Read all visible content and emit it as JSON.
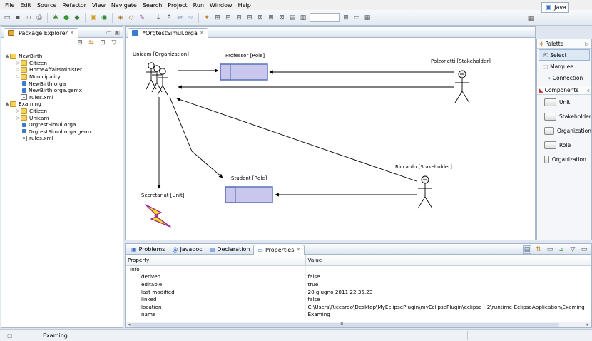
{
  "menu": [
    "File",
    "Edit",
    "Source",
    "Refactor",
    "View",
    "Navigate",
    "Search",
    "Project",
    "Run",
    "Window",
    "Help"
  ],
  "perspective": "Java",
  "package_explorer": {
    "tab_label": "Package Explorer",
    "tree": [
      {
        "label": "NewBirth",
        "icon": "project-icon",
        "level": 0,
        "twisty": "▲"
      },
      {
        "label": "Citizen",
        "icon": "folder-icon",
        "level": 1,
        "twisty": "▷"
      },
      {
        "label": "HomeAffairsMinister",
        "icon": "folder-icon",
        "level": 1,
        "twisty": "▷"
      },
      {
        "label": "Municipality",
        "icon": "folder-icon",
        "level": 1,
        "twisty": "▷"
      },
      {
        "label": "NewBirth.orga",
        "icon": "orga-file-icon",
        "level": 1,
        "twisty": ""
      },
      {
        "label": "NewBirth.orga.gemx",
        "icon": "orga-file-icon",
        "level": 1,
        "twisty": ""
      },
      {
        "label": "rules.xml",
        "icon": "xml-file-icon",
        "level": 1,
        "twisty": ""
      },
      {
        "label": "Examing",
        "icon": "project-icon",
        "level": 0,
        "twisty": "▲"
      },
      {
        "label": "Citizen",
        "icon": "folder-icon",
        "level": 1,
        "twisty": "▷"
      },
      {
        "label": "Unicam",
        "icon": "folder-icon",
        "level": 1,
        "twisty": "▷"
      },
      {
        "label": "OrgtestSimul.orga",
        "icon": "orga-file-icon",
        "level": 1,
        "twisty": ""
      },
      {
        "label": "OrgtestSimul.orga.gemx",
        "icon": "orga-file-icon",
        "level": 1,
        "twisty": ""
      },
      {
        "label": "rules.xml",
        "icon": "xml-file-icon",
        "level": 1,
        "twisty": ""
      }
    ]
  },
  "editor": {
    "tab_label": "*OrgtestSimul.orga",
    "nodes": {
      "unicam": "Unicam [Organization]",
      "professor": "Professor [Role]",
      "polzonetti": "Polzonetti [Stakeholder]",
      "student": "Student [Role]",
      "riccardo": "Riccardo [Stakeholder]",
      "secretariat": "Secretariat [Unit]"
    }
  },
  "palette": {
    "title": "Palette",
    "tools": [
      {
        "label": "Select",
        "icon": "arrow-cursor-icon",
        "selected": true
      },
      {
        "label": "Marquee",
        "icon": "marquee-icon",
        "selected": false
      },
      {
        "label": "Connection",
        "icon": "connection-icon",
        "selected": false
      }
    ],
    "components_title": "Components",
    "components": [
      "Unit",
      "Stakeholder",
      "Organization",
      "Role",
      "Organization..."
    ]
  },
  "bottom_panel": {
    "tabs": [
      {
        "label": "Problems",
        "icon": "problems-icon",
        "active": false
      },
      {
        "label": "Javadoc",
        "icon": "at-icon",
        "active": false
      },
      {
        "label": "Declaration",
        "icon": "declaration-icon",
        "active": false
      },
      {
        "label": "Properties",
        "icon": "properties-icon",
        "active": true
      }
    ],
    "columns": [
      "Property",
      "Value"
    ],
    "rows": [
      {
        "property": "Info",
        "value": "",
        "indent": 1
      },
      {
        "property": "derived",
        "value": "false",
        "indent": 2
      },
      {
        "property": "editable",
        "value": "true",
        "indent": 2
      },
      {
        "property": "last modified",
        "value": "20 giugno 2011 22.35.23",
        "indent": 2
      },
      {
        "property": "linked",
        "value": "false",
        "indent": 2
      },
      {
        "property": "location",
        "value": "C:\\Users\\Riccardo\\Desktop\\MyEclipsePlugin\\myEclipsePlugin\\eclipse - 2\\runtime-EclipseApplication\\Examing",
        "indent": 2
      },
      {
        "property": "name",
        "value": "Examing",
        "indent": 2
      }
    ],
    "scroll_marker": "III"
  },
  "status": {
    "text": "Examing"
  }
}
